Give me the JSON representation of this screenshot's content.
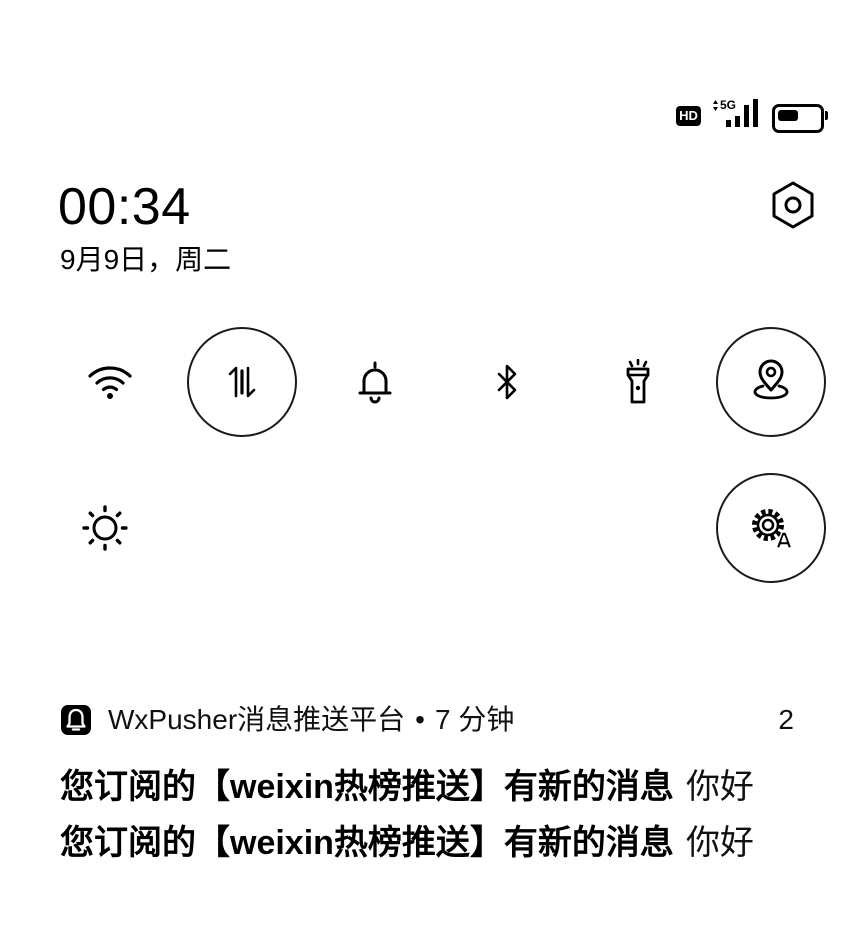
{
  "status_bar": {
    "hd_label": "HD",
    "network_label": "5G",
    "signal_bars": 4,
    "battery_level_percent": 50
  },
  "header": {
    "time": "00:34",
    "date": "9月9日，周二",
    "settings_icon": "settings-hexagon-icon"
  },
  "quick_settings": {
    "tiles": [
      {
        "icon": "wifi-icon",
        "active": false
      },
      {
        "icon": "mobile-data-icon",
        "active": true
      },
      {
        "icon": "bell-icon",
        "active": false
      },
      {
        "icon": "bluetooth-icon",
        "active": false
      },
      {
        "icon": "flashlight-icon",
        "active": false
      },
      {
        "icon": "location-icon",
        "active": true
      },
      {
        "icon": "brightness-sun-icon",
        "active": false
      },
      {
        "icon": "auto-settings-icon",
        "active": true
      }
    ]
  },
  "notification": {
    "app_icon": "alarm-bell-icon",
    "app_name": "WxPusher消息推送平台",
    "separator": "•",
    "time_ago": "7 分钟",
    "count": "2",
    "messages": [
      {
        "title": "您订阅的【weixin热榜推送】有新的消息",
        "body": "你好"
      },
      {
        "title": "您订阅的【weixin热榜推送】有新的消息",
        "body": "你好"
      }
    ]
  },
  "colors": {
    "background": "#ffffff",
    "foreground": "#000000",
    "tile_ring": "#1a1a1a"
  }
}
